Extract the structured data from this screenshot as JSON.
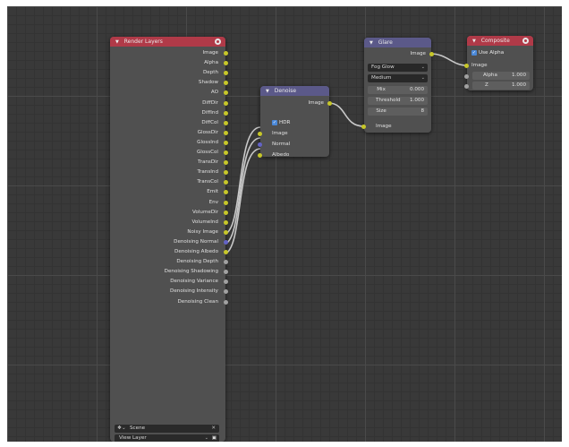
{
  "render_layers": {
    "title": "Render Layers",
    "outputs": [
      "Image",
      "Alpha",
      "Depth",
      "Shadow",
      "AO",
      "DiffDir",
      "DiffInd",
      "DiffCol",
      "GlossDir",
      "GlossInd",
      "GlossCol",
      "TransDir",
      "TransInd",
      "TransCol",
      "Emit",
      "Env",
      "VolumeDir",
      "VolumeInd",
      "Noisy Image",
      "Denoising Normal",
      "Denoising Albedo",
      "Denoising Depth",
      "Denoising Shadowing",
      "Denoising Variance",
      "Denoising Intensity",
      "Denoising Clean"
    ],
    "scene_value": "Scene",
    "view_layer_value": "View Layer"
  },
  "denoise": {
    "title": "Denoise",
    "output_image": "Image",
    "hdr_label": "HDR",
    "hdr_checked": true,
    "inputs": [
      "Image",
      "Normal",
      "Albedo"
    ]
  },
  "glare": {
    "title": "Glare",
    "output_image": "Image",
    "type_value": "Fog Glow",
    "quality_value": "Medium",
    "mix_label": "Mix",
    "mix_value": "0.000",
    "threshold_label": "Threshold",
    "threshold_value": "1.000",
    "size_label": "Size",
    "size_value": "8",
    "input_image": "Image"
  },
  "composite": {
    "title": "Composite",
    "use_alpha_label": "Use Alpha",
    "use_alpha_checked": true,
    "input_image": "Image",
    "alpha_label": "Alpha",
    "alpha_value": "1.000",
    "z_label": "Z",
    "z_value": "1.000"
  },
  "colors": {
    "background": "#393939",
    "node_body": "#505050",
    "header_output": "#b03a48",
    "header_filter": "#5b5989",
    "socket_color": "#c7c729",
    "socket_vector": "#6363c7",
    "socket_value": "#a1a1a1",
    "wire": "#c8c8c8"
  },
  "icons": [
    "collapse-arrow-icon",
    "node-badge-icon",
    "checkbox-icon",
    "dropdown-caret-icon",
    "scene-icon",
    "close-icon",
    "render-icon"
  ]
}
